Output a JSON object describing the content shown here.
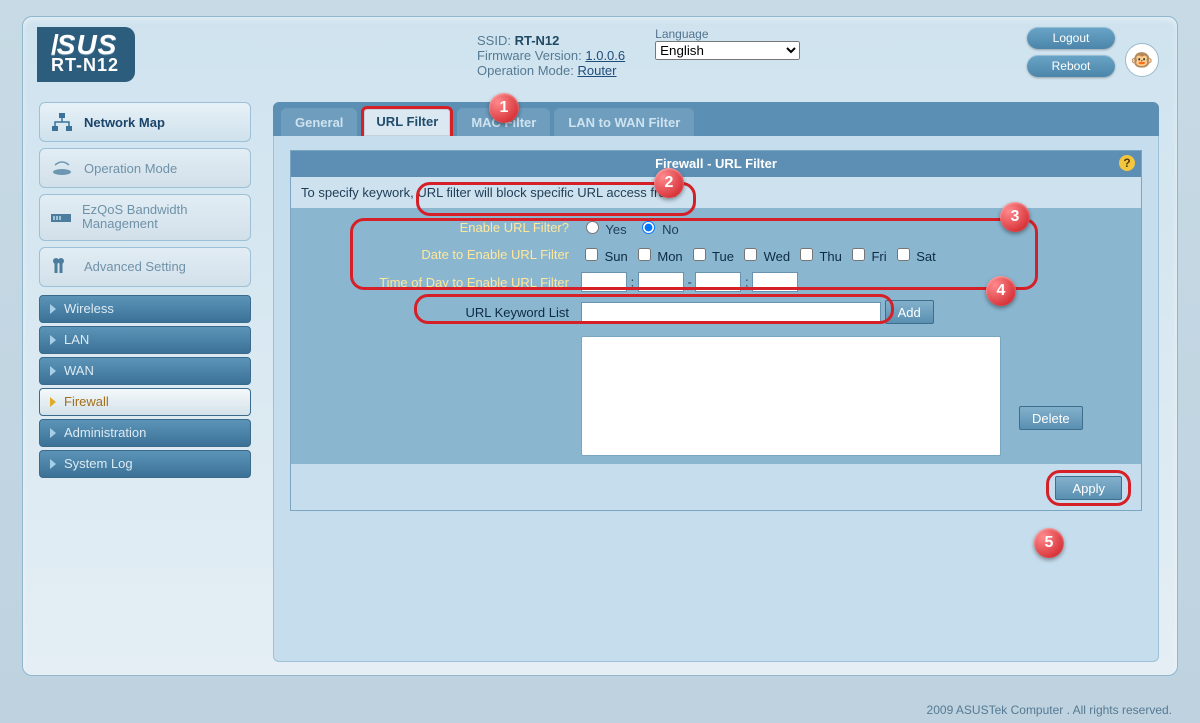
{
  "brand": {
    "model": "RT-N12"
  },
  "sysinfo": {
    "ssid_k": "SSID:",
    "ssid_v": "RT-N12",
    "fw_k": "Firmware Version:",
    "fw_v": "1.0.0.6",
    "mode_k": "Operation Mode:",
    "mode_v": "Router"
  },
  "lang": {
    "label": "Language",
    "value": "English"
  },
  "buttons": {
    "logout": "Logout",
    "reboot": "Reboot"
  },
  "sidebar": {
    "cards": {
      "map": "Network Map",
      "mode": "Operation Mode",
      "ezqos": "EzQoS Bandwidth Management",
      "adv": "Advanced Setting"
    },
    "items": [
      "Wireless",
      "LAN",
      "WAN",
      "Firewall",
      "Administration",
      "System Log"
    ],
    "active_index": 3
  },
  "tabs": [
    "General",
    "URL Filter",
    "MAC Filter",
    "LAN to WAN Filter"
  ],
  "tabs_active": 1,
  "panel": {
    "title": "Firewall - URL Filter",
    "desc": "To specify keywork, URL filter will block specific URL access from",
    "rows": {
      "enable_label": "Enable URL Filter?",
      "enable_yes": "Yes",
      "enable_no": "No",
      "date_label": "Date to Enable URL Filter",
      "time_label": "Time of Day to Enable URL Filter",
      "keyword_label": "URL Keyword List"
    },
    "days": [
      "Sun",
      "Mon",
      "Tue",
      "Wed",
      "Thu",
      "Fri",
      "Sat"
    ],
    "add": "Add",
    "delete": "Delete",
    "apply": "Apply"
  },
  "callouts": [
    "1",
    "2",
    "3",
    "4",
    "5"
  ],
  "footer": "2009 ASUSTek Computer . All rights reserved."
}
